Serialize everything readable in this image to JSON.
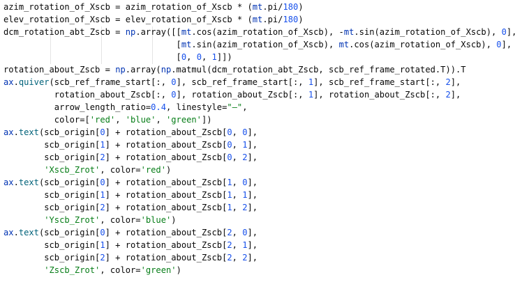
{
  "editor": {
    "lines": [
      [
        [
          "azim_rotation_of_Xscb = azim_rotation_of_Xscb * (",
          "plain"
        ],
        [
          "mt",
          "module"
        ],
        [
          ".pi/",
          "plain"
        ],
        [
          "180",
          "number"
        ],
        [
          ")",
          "plain"
        ]
      ],
      [
        [
          "elev_rotation_of_Xscb = elev_rotation_of_Xscb * (",
          "plain"
        ],
        [
          "mt",
          "module"
        ],
        [
          ".pi/",
          "plain"
        ],
        [
          "180",
          "number"
        ],
        [
          ")",
          "plain"
        ]
      ],
      [
        [
          "dcm_rotation_abt_Zscb = ",
          "plain"
        ],
        [
          "np",
          "module"
        ],
        [
          ".array([[",
          "plain"
        ],
        [
          "mt",
          "module"
        ],
        [
          ".cos(azim_rotation_of_Xscb), -",
          "plain"
        ],
        [
          "mt",
          "module"
        ],
        [
          ".sin(azim_rotation_of_Xscb), ",
          "plain"
        ],
        [
          "0",
          "number"
        ],
        [
          "],",
          "plain"
        ]
      ],
      [
        [
          "                                  [",
          "plain"
        ],
        [
          "mt",
          "module"
        ],
        [
          ".sin(azim_rotation_of_Xscb), ",
          "plain"
        ],
        [
          "mt",
          "module"
        ],
        [
          ".cos(azim_rotation_of_Xscb), ",
          "plain"
        ],
        [
          "0",
          "number"
        ],
        [
          "],",
          "plain"
        ]
      ],
      [
        [
          "                                  [",
          "plain"
        ],
        [
          "0",
          "number"
        ],
        [
          ", ",
          "plain"
        ],
        [
          "0",
          "number"
        ],
        [
          ", ",
          "plain"
        ],
        [
          "1",
          "number"
        ],
        [
          "]])",
          "plain"
        ]
      ],
      [
        [
          "rotation_about_Zscb = ",
          "plain"
        ],
        [
          "np",
          "module"
        ],
        [
          ".array(",
          "plain"
        ],
        [
          "np",
          "module"
        ],
        [
          ".matmul(dcm_rotation_abt_Zscb, scb_ref_frame_rotated.T)).T",
          "plain"
        ]
      ],
      [
        [
          "ax",
          "module"
        ],
        [
          ".",
          "plain"
        ],
        [
          "quiver",
          "func"
        ],
        [
          "(scb_ref_frame_start[:, ",
          "plain"
        ],
        [
          "0",
          "number"
        ],
        [
          "], scb_ref_frame_start[:, ",
          "plain"
        ],
        [
          "1",
          "number"
        ],
        [
          "], scb_ref_frame_start[:, ",
          "plain"
        ],
        [
          "2",
          "number"
        ],
        [
          "],",
          "plain"
        ]
      ],
      [
        [
          "          rotation_about_Zscb[:, ",
          "plain"
        ],
        [
          "0",
          "number"
        ],
        [
          "], rotation_about_Zscb[:, ",
          "plain"
        ],
        [
          "1",
          "number"
        ],
        [
          "], rotation_about_Zscb[:, ",
          "plain"
        ],
        [
          "2",
          "number"
        ],
        [
          "],",
          "plain"
        ]
      ],
      [
        [
          "          arrow_length_ratio=",
          "plain"
        ],
        [
          "0.4",
          "number"
        ],
        [
          ", linestyle=",
          "plain"
        ],
        [
          "\"–\"",
          "string"
        ],
        [
          ",",
          "plain"
        ]
      ],
      [
        [
          "          color=[",
          "plain"
        ],
        [
          "'red'",
          "string"
        ],
        [
          ", ",
          "plain"
        ],
        [
          "'blue'",
          "string"
        ],
        [
          ", ",
          "plain"
        ],
        [
          "'green'",
          "string"
        ],
        [
          "])",
          "plain"
        ]
      ],
      [
        [
          "ax",
          "module"
        ],
        [
          ".",
          "plain"
        ],
        [
          "text",
          "func"
        ],
        [
          "(scb_origin[",
          "plain"
        ],
        [
          "0",
          "number"
        ],
        [
          "] + rotation_about_Zscb[",
          "plain"
        ],
        [
          "0",
          "number"
        ],
        [
          ", ",
          "plain"
        ],
        [
          "0",
          "number"
        ],
        [
          "],",
          "plain"
        ]
      ],
      [
        [
          "        scb_origin[",
          "plain"
        ],
        [
          "1",
          "number"
        ],
        [
          "] + rotation_about_Zscb[",
          "plain"
        ],
        [
          "0",
          "number"
        ],
        [
          ", ",
          "plain"
        ],
        [
          "1",
          "number"
        ],
        [
          "],",
          "plain"
        ]
      ],
      [
        [
          "        scb_origin[",
          "plain"
        ],
        [
          "2",
          "number"
        ],
        [
          "] + rotation_about_Zscb[",
          "plain"
        ],
        [
          "0",
          "number"
        ],
        [
          ", ",
          "plain"
        ],
        [
          "2",
          "number"
        ],
        [
          "],",
          "plain"
        ]
      ],
      [
        [
          "        ",
          "plain"
        ],
        [
          "'Xscb_Zrot'",
          "string"
        ],
        [
          ", color=",
          "plain"
        ],
        [
          "'red'",
          "string"
        ],
        [
          ")",
          "plain"
        ]
      ],
      [
        [
          "ax",
          "module"
        ],
        [
          ".",
          "plain"
        ],
        [
          "text",
          "func"
        ],
        [
          "(scb_origin[",
          "plain"
        ],
        [
          "0",
          "number"
        ],
        [
          "] + rotation_about_Zscb[",
          "plain"
        ],
        [
          "1",
          "number"
        ],
        [
          ", ",
          "plain"
        ],
        [
          "0",
          "number"
        ],
        [
          "],",
          "plain"
        ]
      ],
      [
        [
          "        scb_origin[",
          "plain"
        ],
        [
          "1",
          "number"
        ],
        [
          "] + rotation_about_Zscb[",
          "plain"
        ],
        [
          "1",
          "number"
        ],
        [
          ", ",
          "plain"
        ],
        [
          "1",
          "number"
        ],
        [
          "],",
          "plain"
        ]
      ],
      [
        [
          "        scb_origin[",
          "plain"
        ],
        [
          "2",
          "number"
        ],
        [
          "] + rotation_about_Zscb[",
          "plain"
        ],
        [
          "1",
          "number"
        ],
        [
          ", ",
          "plain"
        ],
        [
          "2",
          "number"
        ],
        [
          "],",
          "plain"
        ]
      ],
      [
        [
          "        ",
          "plain"
        ],
        [
          "'Yscb_Zrot'",
          "string"
        ],
        [
          ", color=",
          "plain"
        ],
        [
          "'blue'",
          "string"
        ],
        [
          ")",
          "plain"
        ]
      ],
      [
        [
          "ax",
          "module"
        ],
        [
          ".",
          "plain"
        ],
        [
          "text",
          "func"
        ],
        [
          "(scb_origin[",
          "plain"
        ],
        [
          "0",
          "number"
        ],
        [
          "] + rotation_about_Zscb[",
          "plain"
        ],
        [
          "2",
          "number"
        ],
        [
          ", ",
          "plain"
        ],
        [
          "0",
          "number"
        ],
        [
          "],",
          "plain"
        ]
      ],
      [
        [
          "        scb_origin[",
          "plain"
        ],
        [
          "1",
          "number"
        ],
        [
          "] + rotation_about_Zscb[",
          "plain"
        ],
        [
          "2",
          "number"
        ],
        [
          ", ",
          "plain"
        ],
        [
          "1",
          "number"
        ],
        [
          "],",
          "plain"
        ]
      ],
      [
        [
          "        scb_origin[",
          "plain"
        ],
        [
          "2",
          "number"
        ],
        [
          "] + rotation_about_Zscb[",
          "plain"
        ],
        [
          "2",
          "number"
        ],
        [
          ", ",
          "plain"
        ],
        [
          "2",
          "number"
        ],
        [
          "],",
          "plain"
        ]
      ],
      [
        [
          "        ",
          "plain"
        ],
        [
          "'Zscb_Zrot'",
          "string"
        ],
        [
          ", color=",
          "plain"
        ],
        [
          "'green'",
          "string"
        ],
        [
          ")",
          "plain"
        ]
      ]
    ]
  }
}
